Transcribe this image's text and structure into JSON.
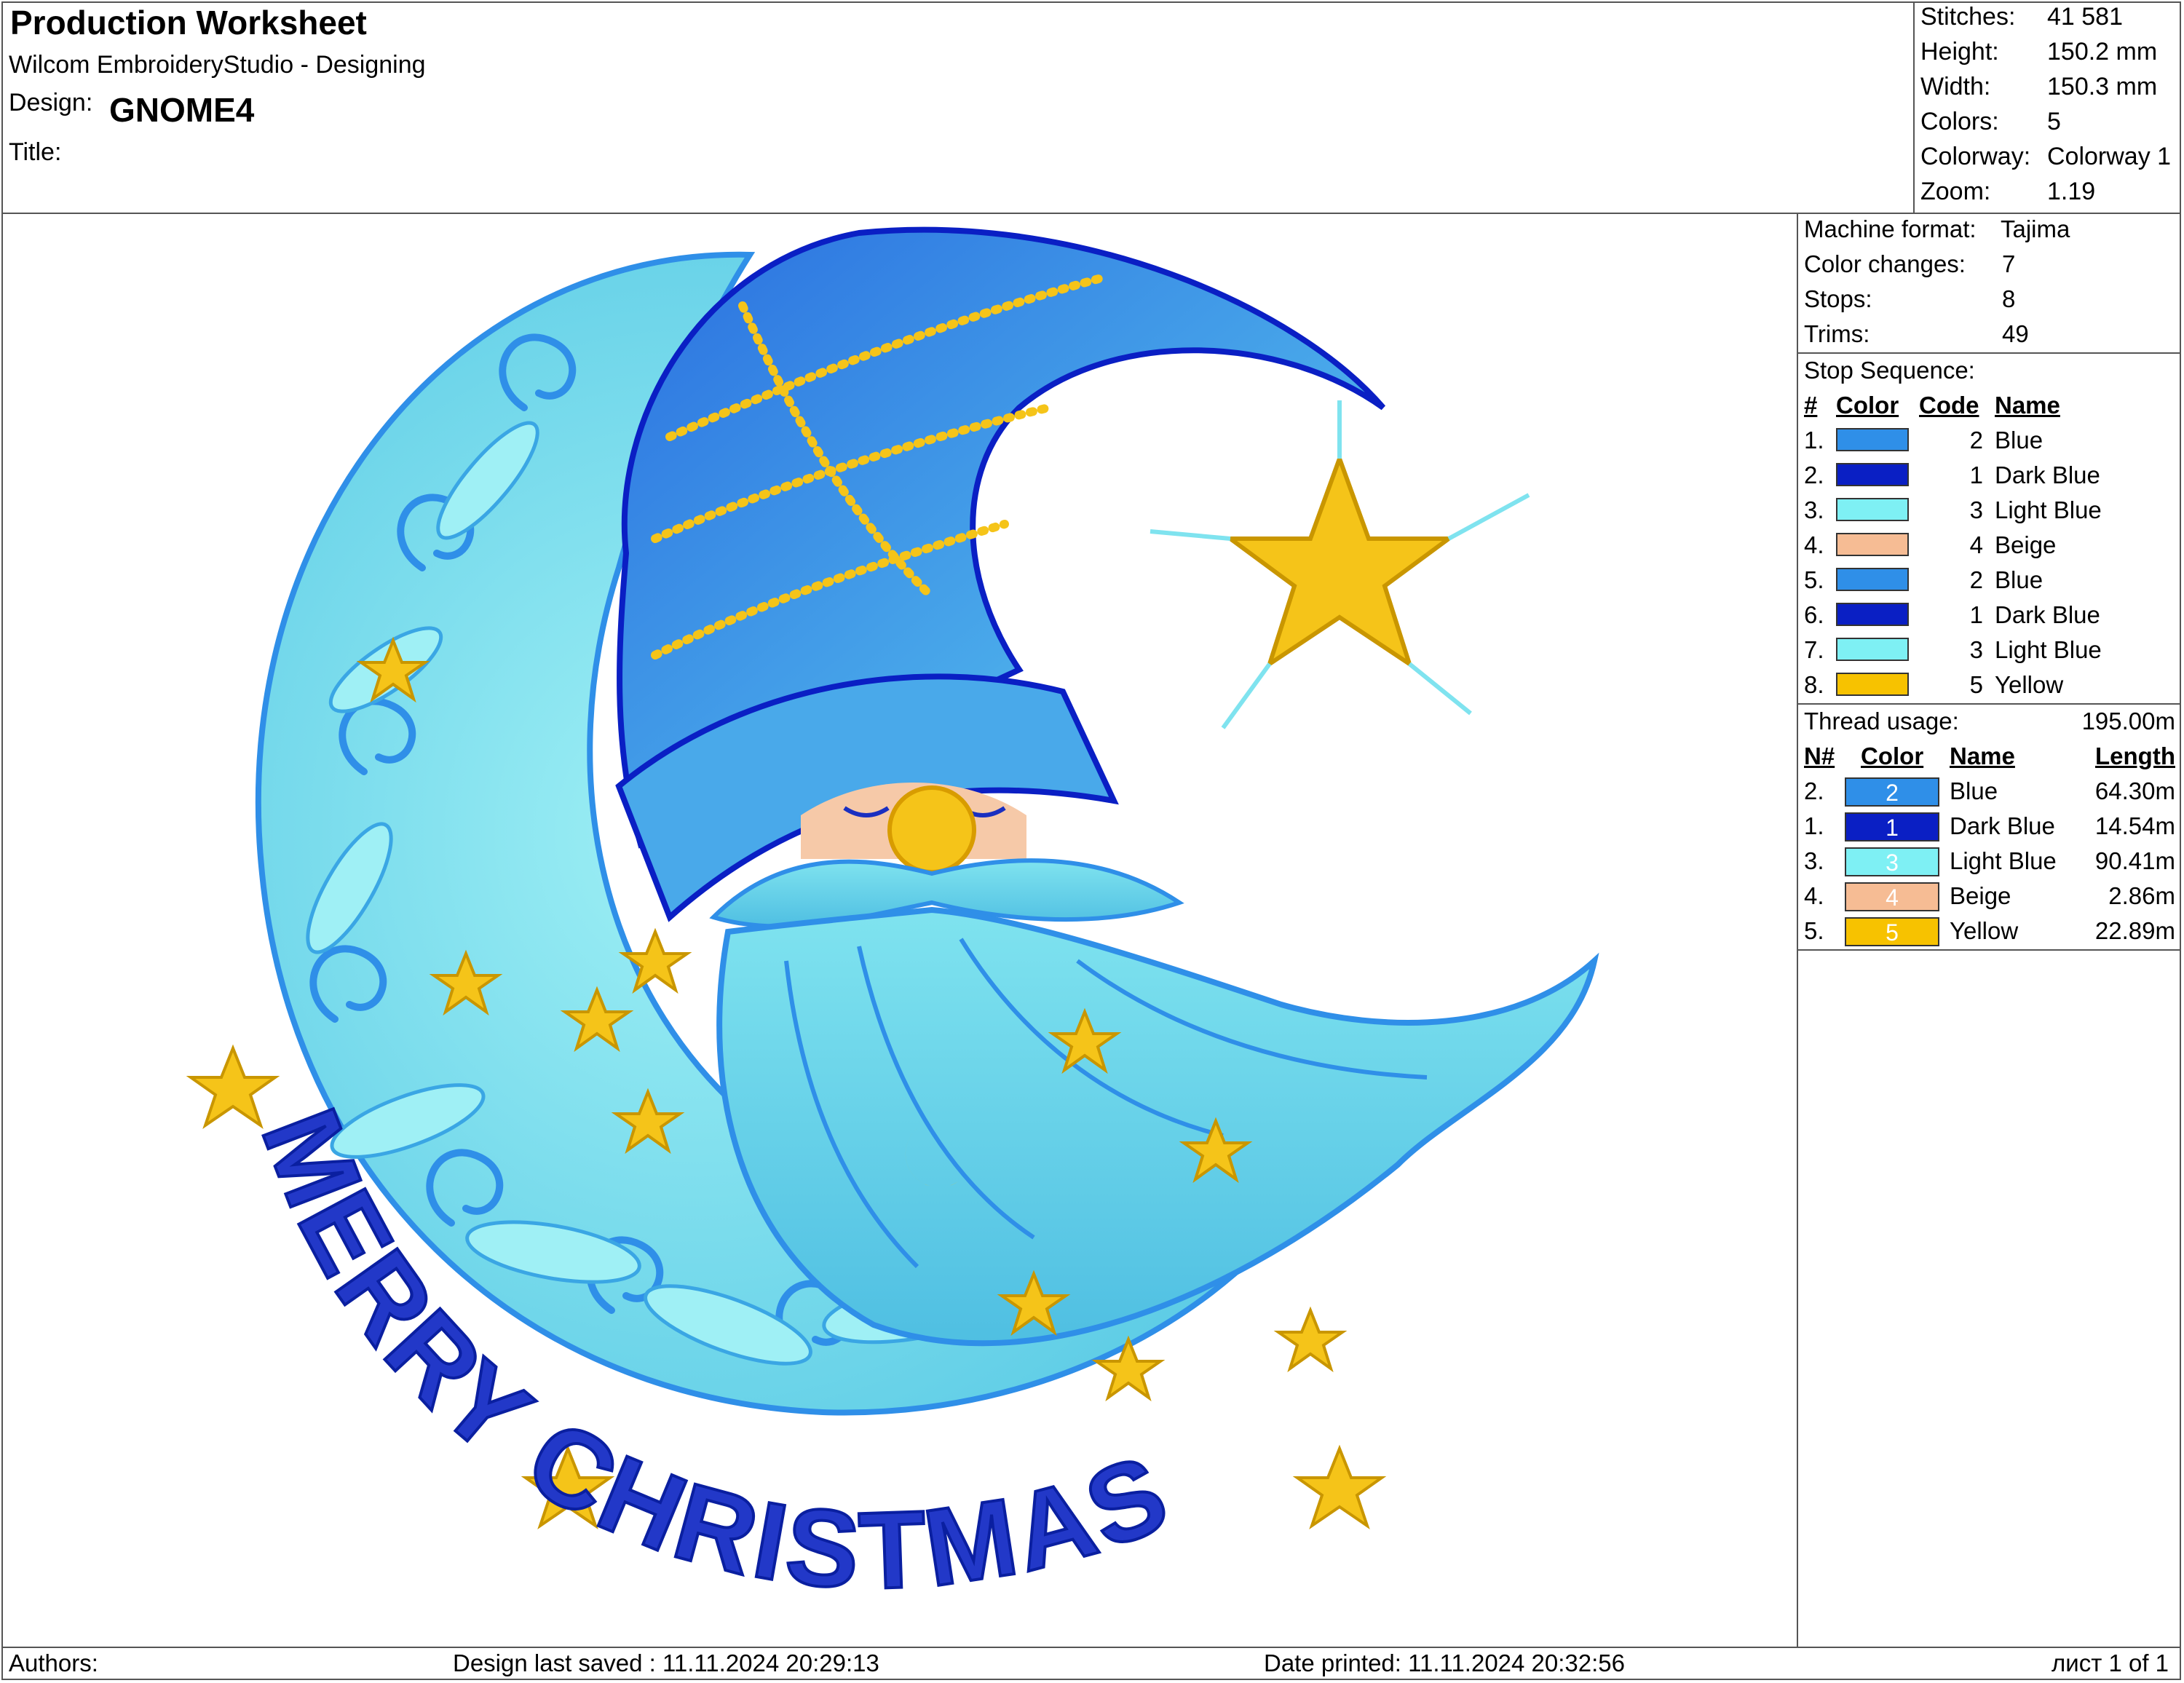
{
  "header": {
    "title": "Production Worksheet",
    "app": "Wilcom EmbroideryStudio - Designing",
    "design_label": "Design:",
    "design_name": "GNOME4",
    "title_label": "Title:"
  },
  "summary": [
    {
      "label": "Stitches:",
      "value": "41 581"
    },
    {
      "label": "Height:",
      "value": "150.2 mm"
    },
    {
      "label": "Width:",
      "value": "150.3 mm"
    },
    {
      "label": "Colors:",
      "value": "5"
    },
    {
      "label": "Colorway:",
      "value": "Colorway 1"
    },
    {
      "label": "Zoom:",
      "value": "1.19"
    }
  ],
  "machine": [
    {
      "label": "Machine format:",
      "value": "Tajima"
    },
    {
      "label": "Color changes:",
      "value": "7"
    },
    {
      "label": "Stops:",
      "value": "8"
    },
    {
      "label": "Trims:",
      "value": "49"
    }
  ],
  "stop_sequence": {
    "title": "Stop Sequence:",
    "headers": {
      "num": "#",
      "color": "Color",
      "code": "Code",
      "name": "Name"
    },
    "rows": [
      {
        "num": "1.",
        "color": "#2f8fe8",
        "code": "2",
        "name": "Blue"
      },
      {
        "num": "2.",
        "color": "#0a1fc4",
        "code": "1",
        "name": "Dark Blue"
      },
      {
        "num": "3.",
        "color": "#7ef0f4",
        "code": "3",
        "name": "Light Blue"
      },
      {
        "num": "4.",
        "color": "#f6bc94",
        "code": "4",
        "name": "Beige"
      },
      {
        "num": "5.",
        "color": "#2f8fe8",
        "code": "2",
        "name": "Blue"
      },
      {
        "num": "6.",
        "color": "#0a1fc4",
        "code": "1",
        "name": "Dark Blue"
      },
      {
        "num": "7.",
        "color": "#7ef0f4",
        "code": "3",
        "name": "Light Blue"
      },
      {
        "num": "8.",
        "color": "#f7c200",
        "code": "5",
        "name": "Yellow"
      }
    ]
  },
  "thread_usage": {
    "title": "Thread usage:",
    "total": "195.00m",
    "headers": {
      "num": "N#",
      "color": "Color",
      "name": "Name",
      "length": "Length"
    },
    "rows": [
      {
        "num": "2.",
        "color": "#2f8fe8",
        "code": "2",
        "name": "Blue",
        "length": "64.30m"
      },
      {
        "num": "1.",
        "color": "#0a1fc4",
        "code": "1",
        "name": "Dark Blue",
        "length": "14.54m"
      },
      {
        "num": "3.",
        "color": "#7ef0f4",
        "code": "3",
        "name": "Light Blue",
        "length": "90.41m"
      },
      {
        "num": "4.",
        "color": "#f6bc94",
        "code": "4",
        "name": "Beige",
        "length": "2.86m"
      },
      {
        "num": "5.",
        "color": "#f7c200",
        "code": "5",
        "name": "Yellow",
        "length": "22.89m"
      }
    ]
  },
  "design_image": {
    "text": "MERRY CHRISTMAS",
    "colors": {
      "blue": "#2f8fe8",
      "dark_blue": "#1a2fc0",
      "light_blue": "#7fe3ef",
      "beige": "#f6c9a8",
      "yellow": "#f5c419"
    }
  },
  "footer": {
    "authors_label": "Authors:",
    "saved": "Design last saved : 11.11.2024 20:29:13",
    "printed": "Date printed: 11.11.2024 20:32:56",
    "page": "лист 1 of 1"
  }
}
